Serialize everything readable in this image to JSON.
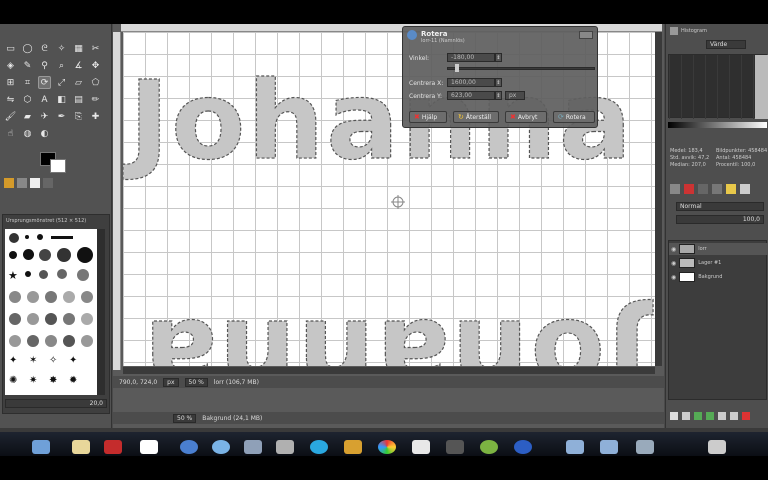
{
  "dialog": {
    "title": "Rotera",
    "subtitle": "lorr-11 (Namnlös)",
    "angle_label": "Vinkel:",
    "angle_value": "-180,00",
    "center_x_label": "Centrera X:",
    "center_x_value": "1600,00",
    "center_y_label": "Centrera Y:",
    "center_y_value": "623,00",
    "unit": "px",
    "buttons": {
      "help": "Hjälp",
      "reset": "Återställ",
      "cancel": "Avbryt",
      "rotate": "Rotera"
    }
  },
  "canvas": {
    "text_top": "Johanna",
    "text_bottom": "Johanna"
  },
  "status": {
    "coords": "790,0, 724,0",
    "unit": "px",
    "zoom": "50 %",
    "info": "lorr (106,7 MB)",
    "zoom2": "50 %",
    "info2": "Bakgrund (24,1 MB)"
  },
  "brushes": {
    "header": "Ursprungsmönstret (512 × 512)",
    "footer_value": "20,0"
  },
  "dock": {
    "histogram_title": "Histogram",
    "channel_value": "Värde",
    "stats": {
      "mean": "Medel: 183,4",
      "stddev": "Std. avvik: 47,2",
      "median": "Median: 207,0",
      "pixels": "Bildpunkter: 458484",
      "count": "Antal: 458484",
      "percentile": "Procentil: 100,0"
    },
    "mode": "Normal",
    "opacity": "100,0",
    "layers": [
      {
        "name": "lorr"
      },
      {
        "name": "Lager #1"
      },
      {
        "name": "Bakgrund"
      }
    ]
  },
  "colors": {
    "fg": "#000000",
    "bg": "#ffffff"
  }
}
